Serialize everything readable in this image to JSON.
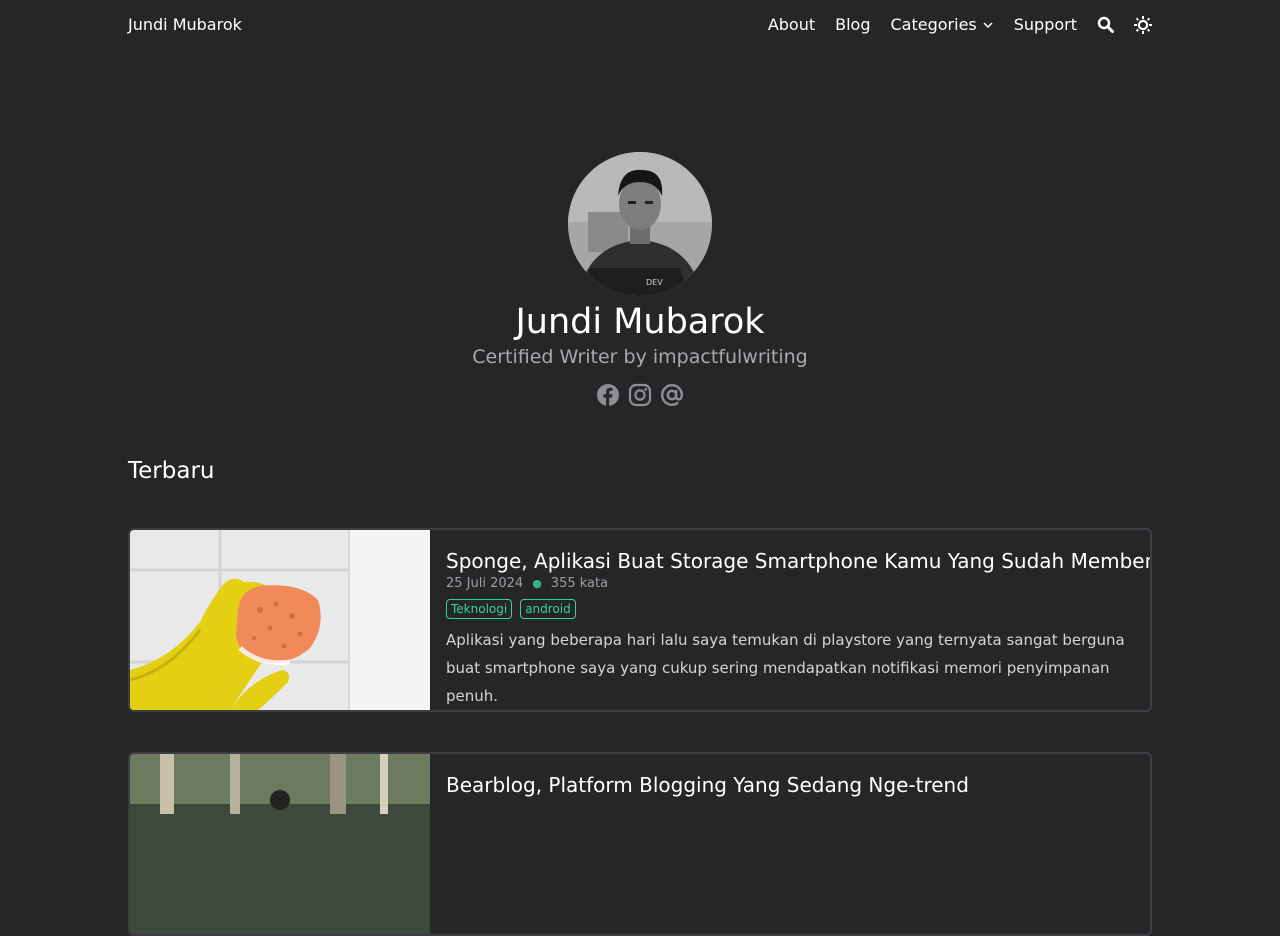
{
  "nav": {
    "brand": "Jundi Mubarok",
    "items": [
      {
        "label": "About"
      },
      {
        "label": "Blog"
      },
      {
        "label": "Categories"
      },
      {
        "label": "Support"
      }
    ],
    "icons": [
      "search-icon",
      "sun-icon"
    ]
  },
  "hero": {
    "name": "Jundi Mubarok",
    "subtitle": "Certified Writer by impactfulwriting",
    "socials": [
      "facebook-icon",
      "instagram-icon",
      "at-icon"
    ]
  },
  "section": {
    "title": "Terbaru"
  },
  "posts": [
    {
      "title": "Sponge, Aplikasi Buat Storage Smartphone Kamu Yang Sudah Membengkak",
      "date": "25 Juli 2024",
      "words": "355 kata",
      "tags": [
        "Teknologi",
        "android"
      ],
      "excerpt": "Aplikasi yang beberapa hari lalu saya temukan di playstore yang ternyata sangat berguna buat smartphone saya yang cukup sering mendapatkan notifikasi memori penyimpanan penuh."
    },
    {
      "title": "Bearblog, Platform Blogging Yang Sedang Nge-trend"
    }
  ],
  "colors": {
    "background": "#262629",
    "accent": "#33d39a",
    "card_border": "#3e3e42",
    "muted": "#9c9ca1"
  }
}
